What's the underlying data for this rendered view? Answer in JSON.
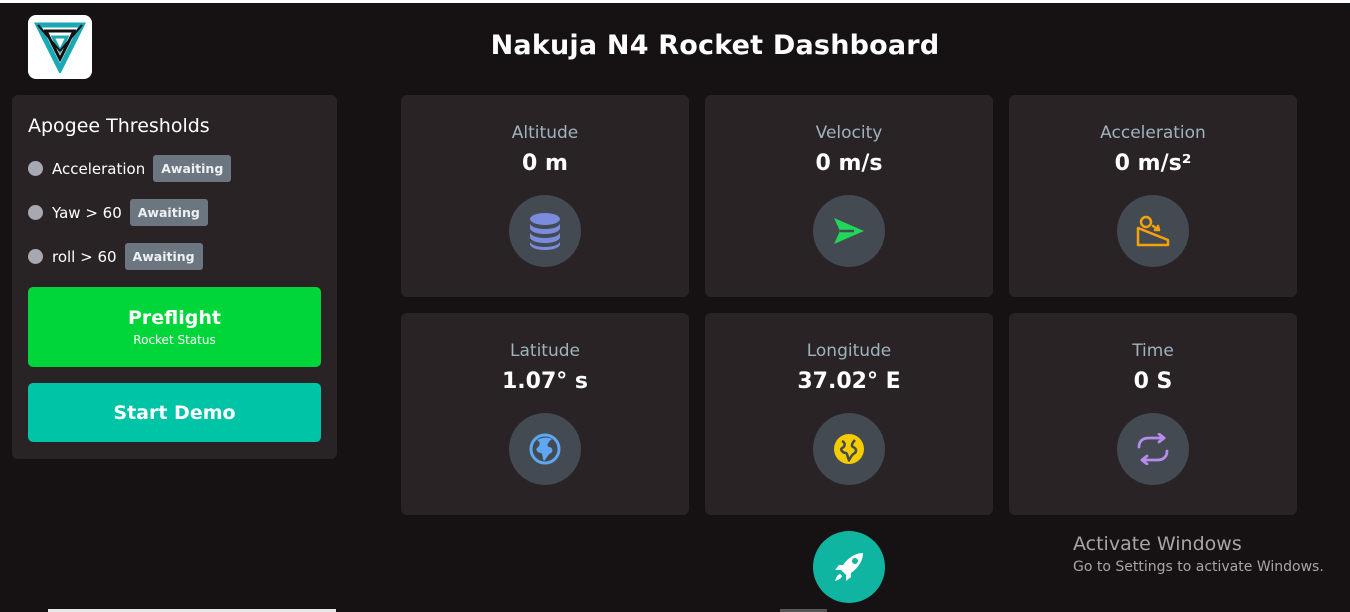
{
  "header": {
    "title": "Nakuja N4 Rocket Dashboard",
    "logo_icon": "nakuja-logo"
  },
  "thresholds": {
    "title": "Apogee Thresholds",
    "items": [
      {
        "label": "Acceleration",
        "status": "Awaiting"
      },
      {
        "label": "Yaw > 60",
        "status": "Awaiting"
      },
      {
        "label": "roll > 60",
        "status": "Awaiting"
      }
    ]
  },
  "buttons": {
    "preflight": {
      "label": "Preflight",
      "sub": "Rocket Status",
      "color": "#00d639"
    },
    "demo": {
      "label": "Start Demo",
      "color": "#00c4a6"
    }
  },
  "cards": [
    {
      "label": "Altitude",
      "value": "0 m",
      "icon": "database-icon",
      "icon_color": "#7b8cde"
    },
    {
      "label": "Velocity",
      "value": "0 m/s",
      "icon": "send-icon",
      "icon_color": "#22d65a"
    },
    {
      "label": "Acceleration",
      "value": "0 m/s²",
      "icon": "slope-icon",
      "icon_color": "#f5a20a"
    },
    {
      "label": "Latitude",
      "value": "1.07° s",
      "icon": "globe-icon",
      "icon_color": "#5ea8f2"
    },
    {
      "label": "Longitude",
      "value": "37.02° E",
      "icon": "globe-icon",
      "icon_color": "#f5cc00"
    },
    {
      "label": "Time",
      "value": "0 S",
      "icon": "refresh-icon",
      "icon_color": "#b78cf0"
    }
  ],
  "fab": {
    "icon": "rocket-icon"
  },
  "watermark": {
    "line1": "Activate Windows",
    "line2": "Go to Settings to activate Windows."
  }
}
